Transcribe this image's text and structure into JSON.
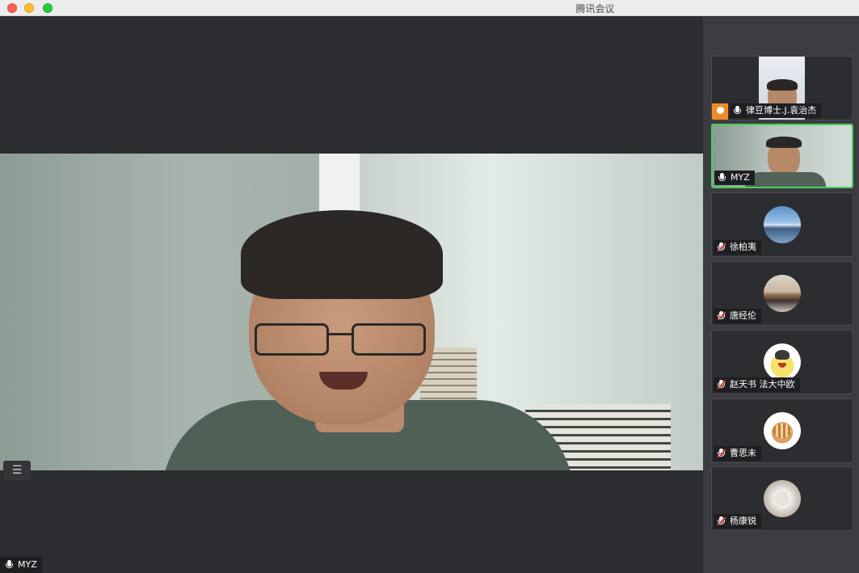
{
  "window": {
    "title": "腾讯会议"
  },
  "main": {
    "speaker_label": "MYZ",
    "list_icon": "list-icon"
  },
  "participants": [
    {
      "name": "律豆博士.J.袁治杰",
      "muted": false,
      "host": true,
      "video": true
    },
    {
      "name": "MYZ",
      "muted": false,
      "host": false,
      "video": true,
      "active": true
    },
    {
      "name": "徐柏夷",
      "muted": true,
      "host": false,
      "video": false
    },
    {
      "name": "唐经伦",
      "muted": true,
      "host": false,
      "video": false
    },
    {
      "name": "赵天书 法大中欧",
      "muted": true,
      "host": false,
      "video": false
    },
    {
      "name": "曹思未",
      "muted": true,
      "host": false,
      "video": false
    },
    {
      "name": "杨康锐",
      "muted": true,
      "host": false,
      "video": false
    }
  ],
  "colors": {
    "active_border": "#4ad05a",
    "host_badge": "#f08a24",
    "muted_slash": "#e53935"
  }
}
